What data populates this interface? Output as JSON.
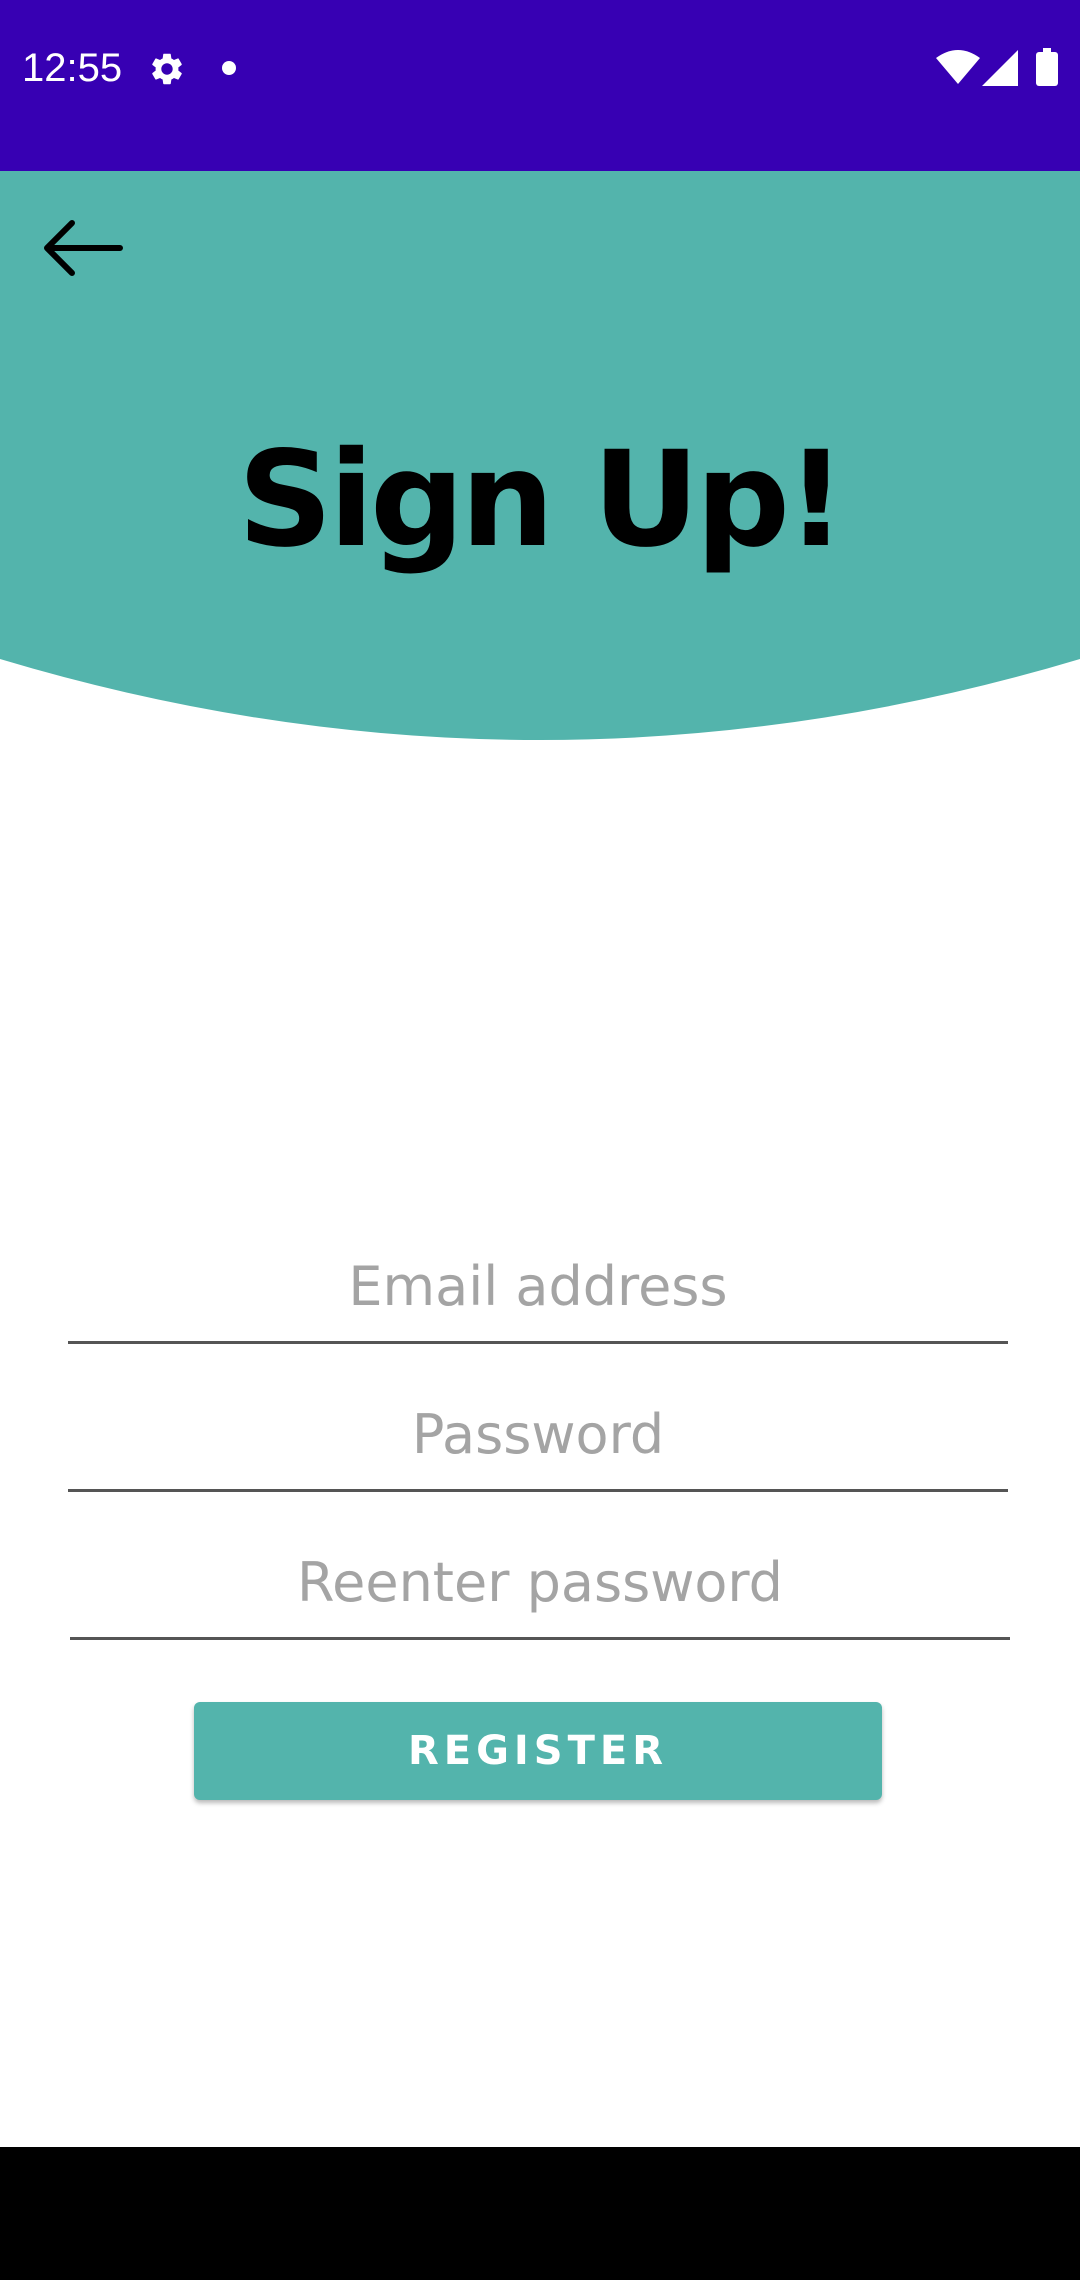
{
  "status_bar": {
    "time": "12:55",
    "background_color": "#3700b3",
    "icons": [
      "gear-icon",
      "notification-dot-icon",
      "wifi-icon",
      "cell-signal-icon",
      "battery-icon"
    ]
  },
  "header": {
    "title": "Sign Up!",
    "background_color": "#53b4ac",
    "back_icon": "arrow-left-icon"
  },
  "form": {
    "email": {
      "placeholder": "Email address",
      "value": ""
    },
    "password": {
      "placeholder": "Password",
      "value": ""
    },
    "reenter_password": {
      "placeholder": "Reenter password",
      "value": ""
    },
    "register_label": "REGISTER",
    "button_color": "#53b4ac"
  },
  "nav_bar": {
    "background_color": "#000000"
  }
}
